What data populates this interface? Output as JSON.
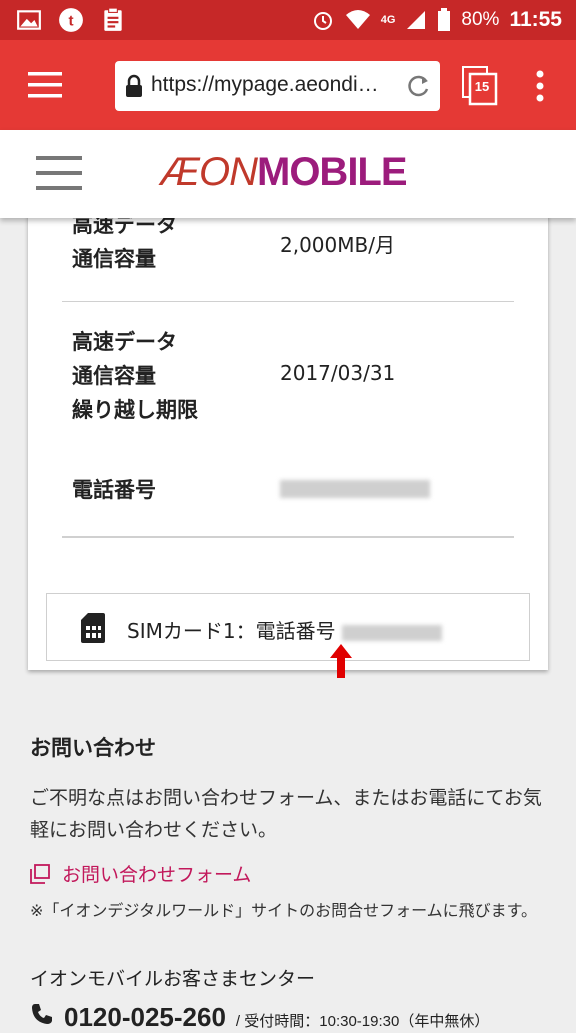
{
  "status_bar": {
    "battery": "80%",
    "time": "11:55",
    "network": "4G"
  },
  "browser": {
    "url": "https://mypage.aeondi…",
    "tab_count": "15"
  },
  "site": {
    "logo_prefix": "ÆON",
    "logo_suffix": "MOBILE"
  },
  "plan_details": {
    "rows": [
      {
        "label_lines": [
          "高速データ",
          "通信容量"
        ],
        "value": "2,000MB/月"
      },
      {
        "label_lines": [
          "高速データ",
          "通信容量",
          "繰り越し期限"
        ],
        "value": "2017/03/31"
      },
      {
        "label_lines": [
          "電話番号"
        ],
        "value": ""
      }
    ]
  },
  "sim_card": {
    "label": "SIMカード1：電話番号"
  },
  "contact": {
    "heading": "お問い合わせ",
    "description": "ご不明な点はお問い合わせフォーム、またはお電話にてお気軽にお問い合わせください。",
    "form_link": "お問い合わせフォーム",
    "note": "※「イオンデジタルワールド」サイトのお問合せフォームに飛びます。",
    "center_name": "イオンモバイルお客さまセンター",
    "phone_number": "0120-025-260",
    "hours": "/ 受付時間：10:30-19:30（年中無休）"
  },
  "colors": {
    "status_bar": "#c62828",
    "toolbar": "#e53935",
    "brand": "#9c1c7c",
    "link": "#c2185b"
  }
}
